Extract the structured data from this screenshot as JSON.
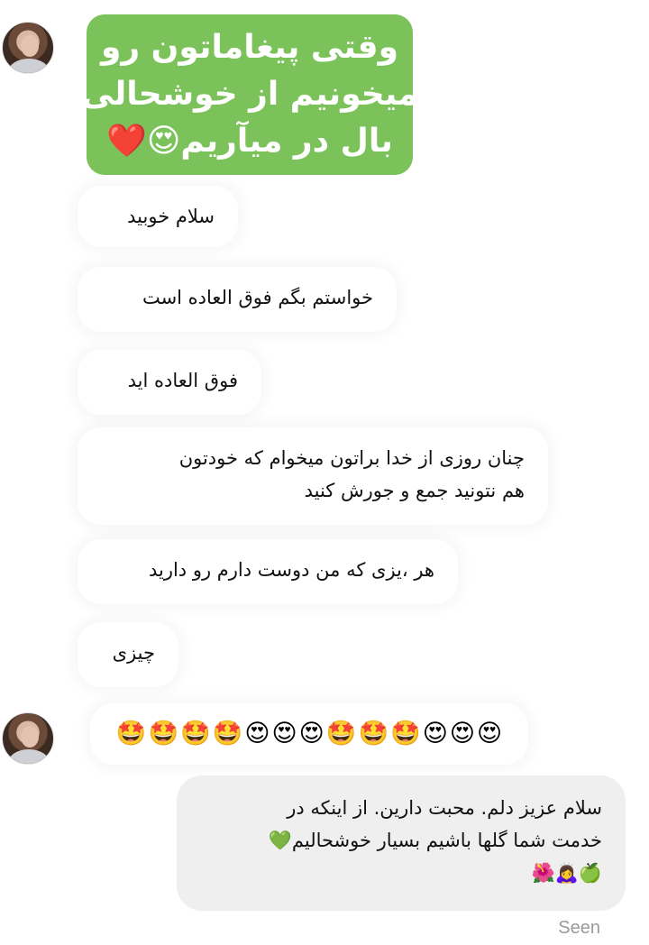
{
  "banner": {
    "line1": "وقتی پیغاماتون رو",
    "line2": "میخونیم از خوشحالی",
    "line3": "بال در میآریم😍❤️"
  },
  "messages": [
    {
      "text": "سلام خوبید"
    },
    {
      "text": "خواستم بگم فوق العاده است"
    },
    {
      "text": "فوق العاده اید"
    },
    {
      "line1": "چنان روزی از خدا براتون میخوام که خودتون",
      "line2": "هم نتونید  جمع و جورش کنید"
    },
    {
      "text": "هر ،یزی که من دوست دارم رو دارید"
    },
    {
      "text": "چیزی"
    }
  ],
  "emoji_message": [
    "🤩",
    "🤩",
    "🤩",
    "🤩",
    "😍",
    "😍",
    "😍",
    "🤩",
    "🤩",
    "🤩",
    "😍",
    "😍",
    "😍"
  ],
  "reply": {
    "line1": "سلام عزیز دلم.  محبت دارین.  از اینکه در",
    "line2": "خدمت شما گلها باشیم بسیار خوشحالیم💚",
    "line3": "🍏🙇‍♀️🌺"
  },
  "status": {
    "seen": "Seen"
  }
}
